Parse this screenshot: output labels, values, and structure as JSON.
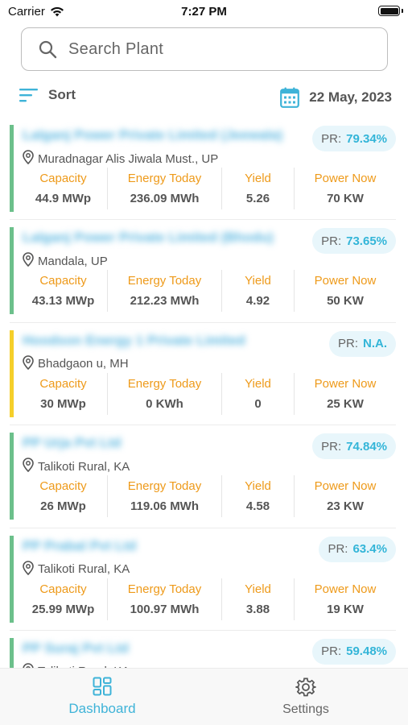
{
  "status_bar": {
    "carrier": "Carrier",
    "time": "7:27 PM"
  },
  "search": {
    "placeholder": "Search Plant"
  },
  "toolbar": {
    "sort_label": "Sort",
    "date_label": "22 May, 2023"
  },
  "metric_labels": {
    "capacity": "Capacity",
    "energy": "Energy Today",
    "yield": "Yield",
    "power": "Power Now"
  },
  "colors": {
    "green": "#6cc08b",
    "yellow": "#f5cf2a",
    "accent": "#3eb3d8",
    "orange": "#ee9a1a"
  },
  "plants": [
    {
      "name": "Lalganj Power Private Limited (Jeewala)",
      "pr_label": "PR:",
      "pr": "79.34%",
      "location": "Muradnagar Alis Jiwala Must., UP",
      "capacity": "44.9 MWp",
      "energy": "236.09 MWh",
      "yield": "5.26",
      "power": "70 KW",
      "status": "green"
    },
    {
      "name": "Lalganj Power Private Limited (Bhodu)",
      "pr_label": "PR:",
      "pr": "73.65%",
      "location": "Mandala, UP",
      "capacity": "43.13 MWp",
      "energy": "212.23 MWh",
      "yield": "4.92",
      "power": "50 KW",
      "status": "green"
    },
    {
      "name": "Hoodson Energy 1 Private Limited",
      "pr_label": "PR:",
      "pr": "N.A.",
      "location": "Bhadgaon u, MH",
      "capacity": "30 MWp",
      "energy": "0 KWh",
      "yield": "0",
      "power": "25 KW",
      "status": "yellow"
    },
    {
      "name": "PP Urja Pvt Ltd",
      "pr_label": "PR:",
      "pr": "74.84%",
      "location": "Talikoti Rural, KA",
      "capacity": "26 MWp",
      "energy": "119.06 MWh",
      "yield": "4.58",
      "power": "23 KW",
      "status": "green"
    },
    {
      "name": "PP Prabal Pvt Ltd",
      "pr_label": "PR:",
      "pr": "63.4%",
      "location": "Talikoti Rural, KA",
      "capacity": "25.99 MWp",
      "energy": "100.97 MWh",
      "yield": "3.88",
      "power": "19 KW",
      "status": "green"
    },
    {
      "name": "PP Suraj Pvt Ltd",
      "pr_label": "PR:",
      "pr": "59.48%",
      "location": "Talikoti Rural, KA",
      "capacity": "",
      "energy": "",
      "yield": "",
      "power": "",
      "status": "green"
    }
  ],
  "tabs": {
    "dashboard": "Dashboard",
    "settings": "Settings"
  }
}
